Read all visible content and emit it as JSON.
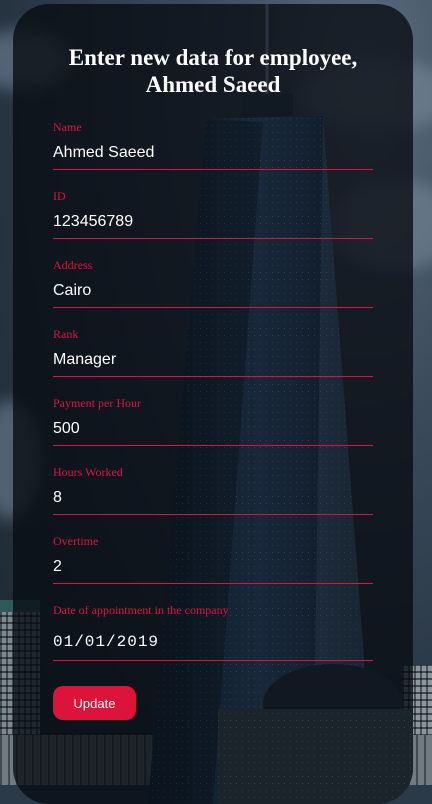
{
  "form": {
    "title_line1": "Enter new data for employee,",
    "title_line2": "Ahmed Saeed",
    "fields": [
      {
        "label": "Name",
        "value": "Ahmed Saeed"
      },
      {
        "label": "ID",
        "value": "123456789"
      },
      {
        "label": "Address",
        "value": "Cairo"
      },
      {
        "label": "Rank",
        "value": "Manager"
      },
      {
        "label": "Payment per Hour",
        "value": "500"
      },
      {
        "label": "Hours Worked",
        "value": "8"
      },
      {
        "label": "Overtime",
        "value": "2"
      },
      {
        "label": "Date of appointment in the company",
        "value": "01/01/2019"
      }
    ],
    "submit_label": "Update"
  },
  "colors": {
    "accent": "#dc143c",
    "card_background": "rgba(8,12,18,0.78)",
    "text": "#ffffff"
  }
}
